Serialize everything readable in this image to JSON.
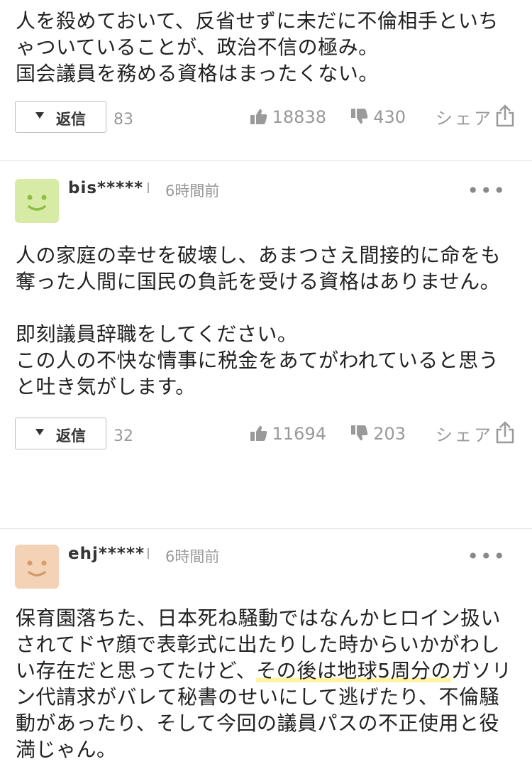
{
  "comments": [
    {
      "user": "",
      "time": "",
      "text": "人を殺めておいて、反省せずに未だに不倫相手といちゃついていることが、政治不信の極み。\n国会議員を務める資格はまったくない。",
      "reply_label": "返信",
      "reply_count": "83",
      "likes": "18838",
      "dislikes": "430",
      "share_label": "シェア"
    },
    {
      "user": "bis*****",
      "time": "6時間前",
      "avatar_color": "#d8eba6",
      "avatar_face_color": "#8cbf3f",
      "text": "人の家庭の幸せを破壊し、あまつさえ間接的に命をも奪った人間に国民の負託を受ける資格はありません。\n\n即刻議員辞職をしてください。\nこの人の不快な情事に税金をあてがわれていると思うと吐き気がします。",
      "reply_label": "返信",
      "reply_count": "32",
      "likes": "11694",
      "dislikes": "203",
      "share_label": "シェア"
    },
    {
      "user": "ehj*****",
      "time": "6時間前",
      "avatar_color": "#f3d2b6",
      "avatar_face_color": "#d79b6b",
      "text_before_hl": "保育園落ちた、日本死ね騒動ではなんかヒロイン扱いされてドヤ顔で表彰式に出たりした時からいかがわしい存在だと思ってたけど、",
      "text_hl": "その後は地球5周分の",
      "text_after_hl": "ガソリン代請求がバレて秘書のせいにして逃げたり、不倫騒動があったり、そして今回の議員パスの不正使用と役満じゃん。"
    }
  ],
  "more_label": "•••"
}
